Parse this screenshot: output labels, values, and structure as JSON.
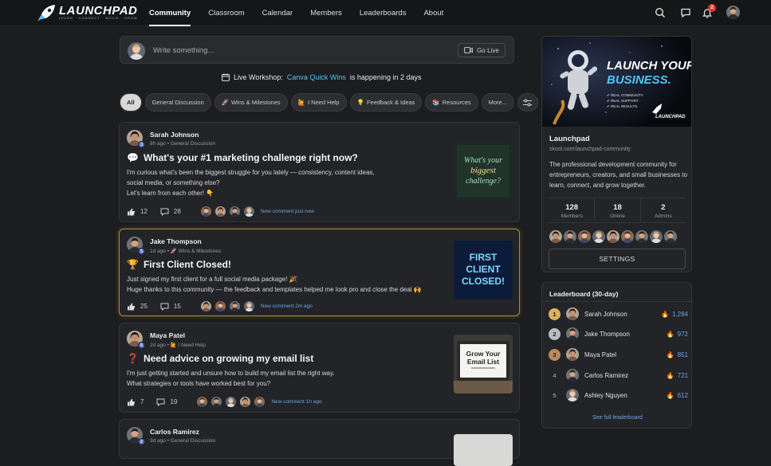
{
  "header": {
    "logo": "LAUNCHPAD",
    "tagline": "LEARN · CONNECT · BUILD · GROW",
    "nav": [
      "Community",
      "Classroom",
      "Calendar",
      "Members",
      "Leaderboards",
      "About"
    ],
    "notifications_count": "2"
  },
  "composer": {
    "placeholder": "Write something...",
    "go_live": "Go Live"
  },
  "workshop": {
    "prefix": "Live Workshop:",
    "name": "Canva Quick Wins",
    "suffix": "is happening in 2 days"
  },
  "filters": [
    {
      "label": "All",
      "icon": ""
    },
    {
      "label": "General Discussion",
      "icon": ""
    },
    {
      "label": "Wins & Milestones",
      "icon": "🚀"
    },
    {
      "label": "I Need Help",
      "icon": "🙋"
    },
    {
      "label": "Feedback & Ideas",
      "icon": "💡"
    },
    {
      "label": "Resources",
      "icon": "📚"
    },
    {
      "label": "More...",
      "icon": ""
    }
  ],
  "posts": [
    {
      "author": "Sarah Johnson",
      "level": "3",
      "time": "8h ago",
      "category": "General Discussion",
      "category_icon": "",
      "title_icon": "💬",
      "title": "What's your #1 marketing challenge right now?",
      "body": [
        "I'm curious what's been the biggest struggle for you lately — consistency, content ideas,",
        "social media, or something else?",
        "Let's learn from each other! 👇"
      ],
      "likes": "12",
      "comments": "28",
      "activity": "New comment just now",
      "thumb_text": [
        "What's your",
        "biggest",
        "challenge?"
      ]
    },
    {
      "author": "Jake Thompson",
      "level": "5",
      "time": "1d ago",
      "category": "Wins & Milestones",
      "category_icon": "🚀",
      "title_icon": "🏆",
      "title": "First Client Closed!",
      "body": [
        "Just signed my first client for a full social media package! 🎉",
        "Huge thanks to this community — the feedback and templates helped me look pro and close the deal 🙌"
      ],
      "likes": "25",
      "comments": "15",
      "activity": "New comment 2m ago",
      "thumb_text": [
        "FIRST",
        "CLIENT",
        "CLOSED!"
      ]
    },
    {
      "author": "Maya Patel",
      "level": "5",
      "time": "2d ago",
      "category": "I Need Help",
      "category_icon": "🙋",
      "title_icon": "❓",
      "title": "Need advice on growing my email list",
      "body": [
        "I'm just getting started and unsure how to build my email list the right way.",
        "What strategies or tools have worked best for you?"
      ],
      "likes": "7",
      "comments": "19",
      "activity": "New comment 1h ago",
      "thumb_text": [
        "Grow Your",
        "Email List"
      ]
    },
    {
      "author": "Carlos Ramirez",
      "level": "2",
      "time": "3d ago",
      "category": "General Discussion",
      "category_icon": "",
      "title_icon": "",
      "title": "",
      "body": [],
      "likes": "",
      "comments": "",
      "activity": "",
      "thumb_text": []
    }
  ],
  "community": {
    "banner_title": [
      "LAUNCH YOUR",
      "BUSINESS."
    ],
    "banner_points": [
      "✔ REAL COMMUNITY.",
      "✔ REAL SUPPORT.",
      "✔ REAL RESULTS."
    ],
    "banner_logo": "LAUNCHPAD",
    "name": "Launchpad",
    "url": "skool.com/launchpad-community",
    "description": "The professional development community for entrepreneurs, creators, and small businesses to learn, connect, and grow together.",
    "stats": [
      {
        "n": "128",
        "l": "Members"
      },
      {
        "n": "18",
        "l": "Online"
      },
      {
        "n": "2",
        "l": "Admins"
      }
    ],
    "settings": "SETTINGS"
  },
  "leaderboard": {
    "title": "Leaderboard (30-day)",
    "rows": [
      {
        "rank": "1",
        "name": "Sarah Johnson",
        "points": "1,284"
      },
      {
        "rank": "2",
        "name": "Jake Thompson",
        "points": "972"
      },
      {
        "rank": "3",
        "name": "Maya Patel",
        "points": "851"
      },
      {
        "rank": "4",
        "name": "Carlos Ramirez",
        "points": "721"
      },
      {
        "rank": "5",
        "name": "Ashley Nguyen",
        "points": "612"
      }
    ],
    "link": "See full leaderboard"
  },
  "colors": {
    "accent": "#4fc3f7",
    "link": "#6aa3e8",
    "gold": "#d9b25a",
    "silver": "#b9bcc2",
    "bronze": "#b98a5e"
  }
}
